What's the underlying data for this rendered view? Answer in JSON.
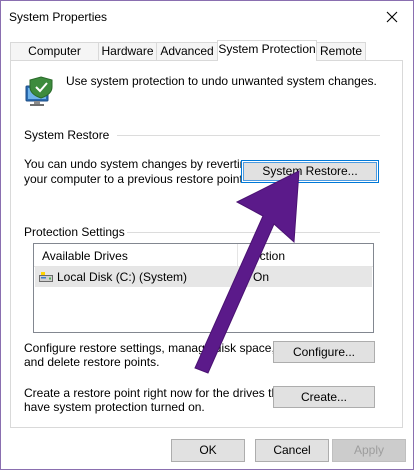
{
  "window": {
    "title": "System Properties"
  },
  "tabs": [
    {
      "label": "Computer Name"
    },
    {
      "label": "Hardware"
    },
    {
      "label": "Advanced"
    },
    {
      "label": "System Protection"
    },
    {
      "label": "Remote"
    }
  ],
  "active_tab": "System Protection",
  "intro": {
    "text": "Use system protection to undo unwanted system changes.",
    "icon": "system-protection-icon"
  },
  "system_restore": {
    "group_label": "System Restore",
    "description_line1": "You can undo system changes by reverting",
    "description_line2": "your computer to a previous restore point.",
    "button_label": "System Restore..."
  },
  "protection_settings": {
    "group_label": "Protection Settings",
    "columns": [
      "Available Drives",
      "ection"
    ],
    "rows": [
      {
        "drive": "Local Disk (C:) (System)",
        "protection": "On"
      }
    ],
    "configure_text_line1": "Configure restore settings, manage disk space,",
    "configure_text_line2": "and delete restore points.",
    "configure_button": "Configure...",
    "create_text_line1": "Create a restore point right now for the drives that",
    "create_text_line2": "have system protection turned on.",
    "create_button": "Create..."
  },
  "footer": {
    "ok": "OK",
    "cancel": "Cancel",
    "apply": "Apply"
  },
  "overlay": {
    "arrow_color": "#5b1a8a"
  },
  "colors": {
    "focus_border": "#0078d7",
    "window_border": "#8a6fb0"
  }
}
